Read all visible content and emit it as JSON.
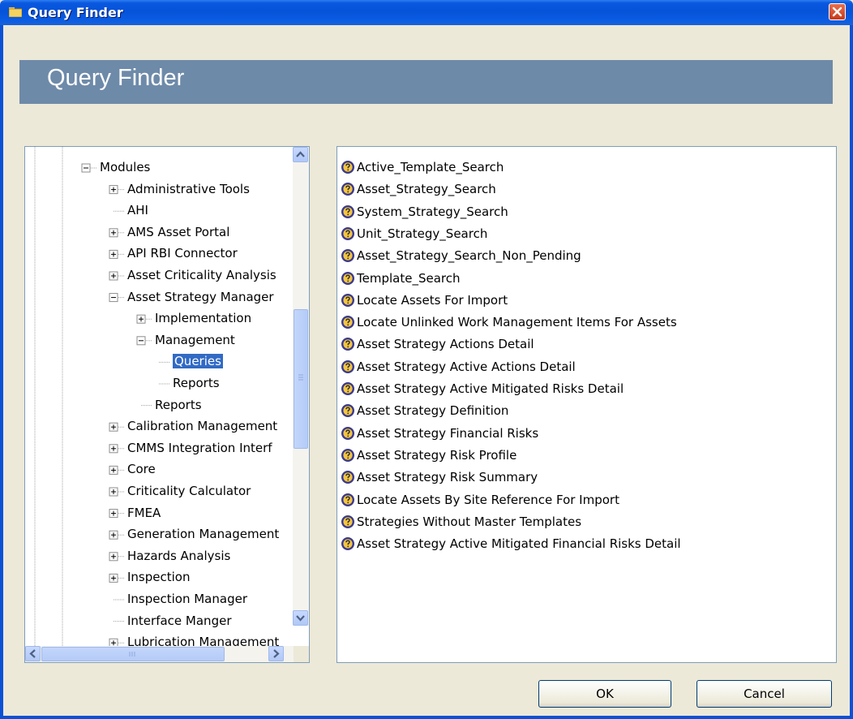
{
  "window": {
    "title": "Query Finder",
    "banner_title": "Query Finder"
  },
  "tree": [
    {
      "label": "Modules",
      "expander": "minus"
    },
    {
      "label": "Administrative Tools",
      "expander": "plus"
    },
    {
      "label": "AHI",
      "expander": "none"
    },
    {
      "label": "AMS Asset Portal",
      "expander": "plus"
    },
    {
      "label": "API RBI Connector",
      "expander": "plus"
    },
    {
      "label": "Asset Criticality Analysis",
      "expander": "plus"
    },
    {
      "label": "Asset Strategy Manager",
      "expander": "minus"
    },
    {
      "label": "Implementation",
      "expander": "plus"
    },
    {
      "label": "Management",
      "expander": "minus"
    },
    {
      "label": "Queries",
      "expander": "none",
      "selected": true
    },
    {
      "label": "Reports",
      "expander": "none"
    },
    {
      "label": "Reports",
      "expander": "none"
    },
    {
      "label": "Calibration Management",
      "expander": "plus"
    },
    {
      "label": "CMMS Integration Interf",
      "expander": "plus"
    },
    {
      "label": "Core",
      "expander": "plus"
    },
    {
      "label": "Criticality Calculator",
      "expander": "plus"
    },
    {
      "label": "FMEA",
      "expander": "plus"
    },
    {
      "label": "Generation Management",
      "expander": "plus"
    },
    {
      "label": "Hazards Analysis",
      "expander": "plus"
    },
    {
      "label": "Inspection",
      "expander": "plus"
    },
    {
      "label": "Inspection Manager",
      "expander": "none"
    },
    {
      "label": "Interface Manger",
      "expander": "none"
    },
    {
      "label": "Lubrication Management",
      "expander": "plus"
    }
  ],
  "queries": [
    "Active_Template_Search",
    "Asset_Strategy_Search",
    "System_Strategy_Search",
    "Unit_Strategy_Search",
    "Asset_Strategy_Search_Non_Pending",
    "Template_Search",
    "Locate Assets For Import",
    "Locate Unlinked Work Management Items For Assets",
    "Asset Strategy Actions Detail",
    "Asset Strategy Active Actions Detail",
    "Asset Strategy Active Mitigated Risks Detail",
    "Asset Strategy Definition",
    "Asset Strategy Financial Risks",
    "Asset Strategy Risk Profile",
    "Asset Strategy Risk Summary",
    "Locate Assets By Site Reference For Import",
    "Strategies Without Master Templates",
    "Asset Strategy Active Mitigated Financial Risks Detail"
  ],
  "buttons": {
    "ok": "OK",
    "cancel": "Cancel"
  },
  "icons": {
    "query": "query-icon",
    "folder": "folder-icon",
    "close": "close-icon"
  },
  "colors": {
    "titlebar": "#0553d8",
    "banner": "#6e8aa9",
    "selection": "#316ac5"
  }
}
